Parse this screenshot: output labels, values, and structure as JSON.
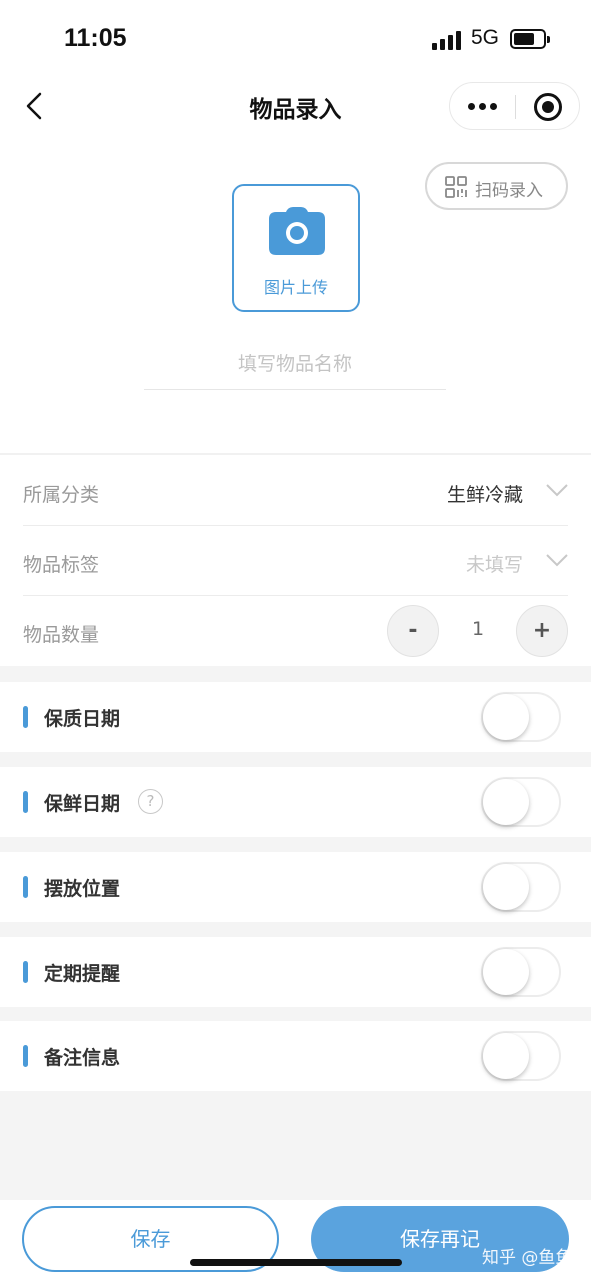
{
  "status_bar": {
    "time": "11:05",
    "network": "5G"
  },
  "nav": {
    "title": "物品录入"
  },
  "scan": {
    "label": "扫码录入"
  },
  "upload": {
    "label": "图片上传"
  },
  "name_field": {
    "placeholder": "填写物品名称",
    "value": ""
  },
  "rows": {
    "category": {
      "label": "所属分类",
      "value": "生鲜冷藏"
    },
    "tags": {
      "label": "物品标签",
      "value": "未填写"
    },
    "quantity": {
      "label": "物品数量",
      "value": "1",
      "minus": "-",
      "plus": "+"
    }
  },
  "toggles": [
    {
      "label": "保质日期",
      "on": false
    },
    {
      "label": "保鲜日期",
      "on": false,
      "help": "?"
    },
    {
      "label": "摆放位置",
      "on": false
    },
    {
      "label": "定期提醒",
      "on": false
    },
    {
      "label": "备注信息",
      "on": false
    }
  ],
  "buttons": {
    "save": "保存",
    "save_again": "保存再记"
  },
  "watermark": "知乎 @鱼鱼",
  "colors": {
    "accent": "#4a9ad8",
    "accent_fill": "#5aa3de",
    "muted_label": "#9a9a9a",
    "background_band": "#f4f4f4"
  }
}
